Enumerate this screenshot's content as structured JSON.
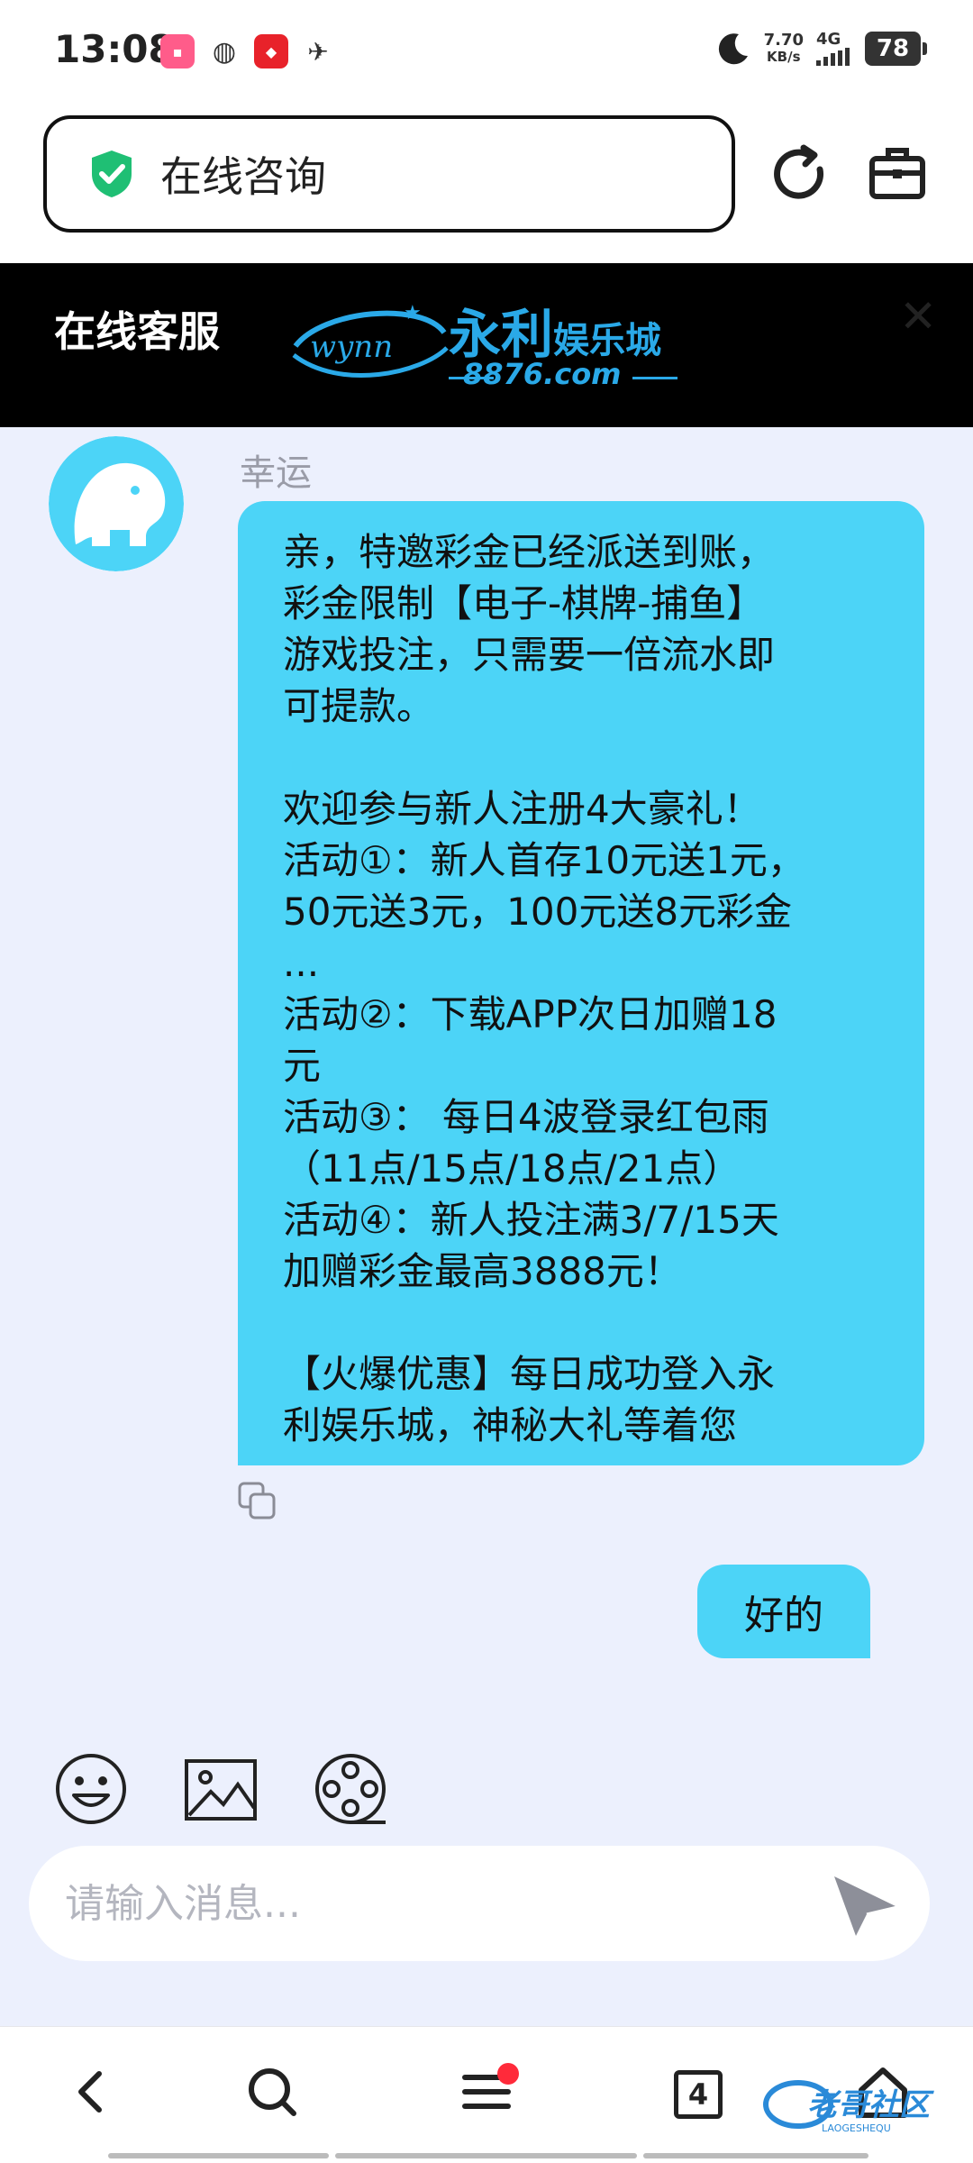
{
  "status_bar": {
    "time": "13:08",
    "net_speed_value": "7.70",
    "net_speed_unit": "KB/s",
    "network": "4G",
    "battery": "78"
  },
  "address_bar": {
    "title": "在线咨询"
  },
  "header": {
    "title": "在线客服",
    "logo_brand": "永利",
    "logo_brand_suffix": "娱乐城",
    "logo_url": "8876.com",
    "logo_script": "wynn"
  },
  "chat": {
    "messages": [
      {
        "sender": "幸运",
        "lines": [
          "亲，特邀彩金已经派送到账，",
          "彩金限制【电子-棋牌-捕鱼】",
          "游戏投注，只需要一倍流水即",
          "可提款。",
          "",
          "欢迎参与新人注册4大豪礼！",
          "活动①：新人首存10元送1元，",
          "50元送3元，100元送8元彩金",
          "...",
          "活动②：下载APP次日加赠18",
          "元",
          "活动③： 每日4波登录红包雨",
          "（11点/15点/18点/21点）",
          "活动④：新人投注满3/7/15天",
          "加赠彩金最高3888元！",
          "",
          "【火爆优惠】每日成功登入永",
          "利娱乐城，神秘大礼等着您"
        ]
      },
      {
        "reply": "好的"
      }
    ]
  },
  "input": {
    "placeholder": "请输入消息..."
  },
  "bottom_nav": {
    "tab_count": "4"
  },
  "colors": {
    "accent": "#4cd4f7",
    "chat_bg": "#ecf0fd",
    "header_bg": "#000000",
    "shield": "#1fbf74",
    "notification": "#ff2a3a"
  }
}
